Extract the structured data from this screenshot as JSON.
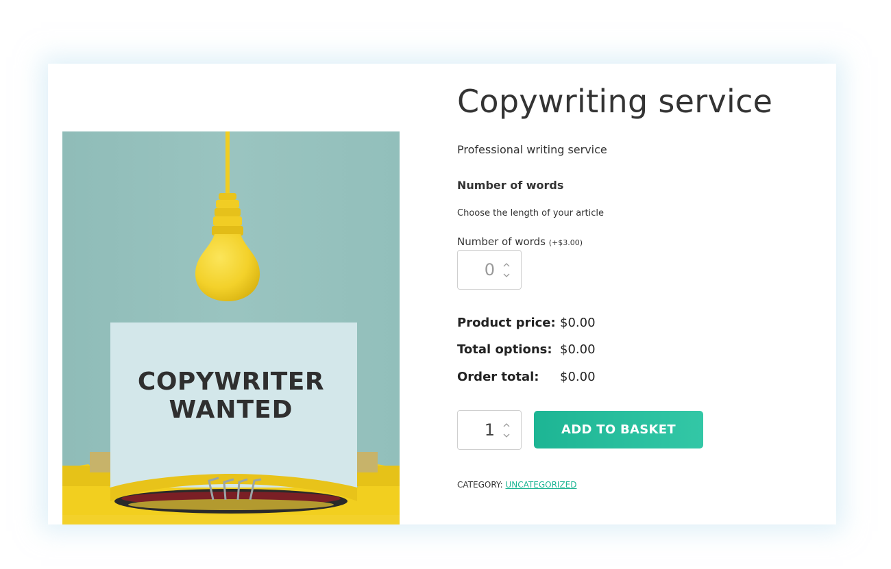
{
  "product": {
    "title": "Copywriting service",
    "subtitle": "Professional writing service",
    "image_text_line1": "COPYWRITER",
    "image_text_line2": "WANTED"
  },
  "option": {
    "heading": "Number of words",
    "description": "Choose the length of your article",
    "field_label": "Number of words",
    "field_price": "(+$3.00)",
    "field_placeholder": "0",
    "field_value": ""
  },
  "pricing": {
    "product_price_label": "Product price:",
    "product_price_value": "$0.00",
    "total_options_label": "Total options:",
    "total_options_value": "$0.00",
    "order_total_label": "Order total:",
    "order_total_value": "$0.00"
  },
  "cart": {
    "quantity": "1",
    "add_button_label": "ADD TO BASKET"
  },
  "meta": {
    "category_label": "CATEGORY:",
    "category_link": "UNCATEGORIZED"
  },
  "colors": {
    "accent": "#1db594",
    "image_background": "#97c2be",
    "lamp_yellow": "#f3d12a"
  },
  "icons": [
    "spinner-up-icon",
    "spinner-down-icon",
    "lightbulb-illustration",
    "typewriter-illustration"
  ]
}
